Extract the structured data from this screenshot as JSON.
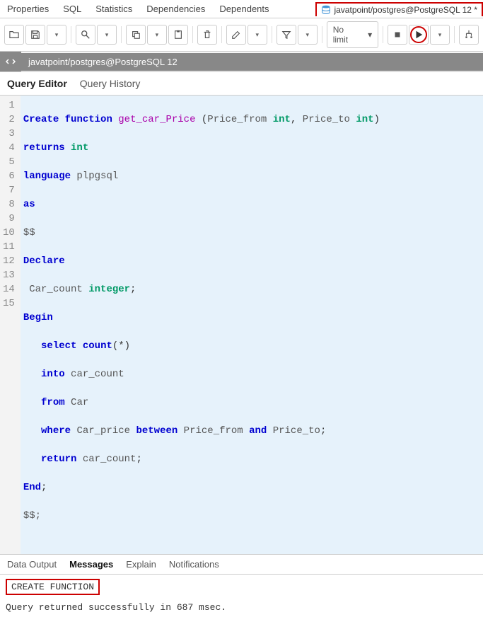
{
  "topTabs": {
    "t0": "Properties",
    "t1": "SQL",
    "t2": "Statistics",
    "t3": "Dependencies",
    "t4": "Dependents"
  },
  "connTab": "javatpoint/postgres@PostgreSQL 12 *",
  "noLimit": "No limit",
  "connBar": "javatpoint/postgres@PostgreSQL 12",
  "queryTabs": {
    "editor": "Query Editor",
    "history": "Query History"
  },
  "lines": {
    "l1": "1",
    "l2": "2",
    "l3": "3",
    "l4": "4",
    "l5": "5",
    "l6": "6",
    "l7": "7",
    "l8": "8",
    "l9": "9",
    "l10": "10",
    "l11": "11",
    "l12": "12",
    "l13": "13",
    "l14": "14",
    "l15": "15"
  },
  "code": {
    "create": "Create",
    "function": "function",
    "fname": "get_car_Price",
    "open": " (",
    "pf": "Price_from ",
    "int1": "int",
    "comma": ", ",
    "pt": "Price_to ",
    "int2": "int",
    "close": ")",
    "returns": "returns",
    "int3": " int",
    "language": "language",
    "plpgsql": " plpgsql",
    "as": "as",
    "dol1": "$$",
    "declare": "Declare",
    "cc": " Car_count ",
    "integer": "integer",
    "semi1": ";",
    "begin": "Begin",
    "select": "select",
    "count": "count",
    "star": "(*)",
    "into": "into",
    "cc2": " car_count",
    "from": "from",
    "car": " Car",
    "where": "where",
    "cp": " Car_price ",
    "between": "between",
    "pf2": " Price_from ",
    "and": "and",
    "pt2": " Price_to",
    "semi2": ";",
    "return": "return",
    "cc3": " car_count",
    "semi3": ";",
    "end": "End",
    "semi4": ";",
    "dol2": "$$;"
  },
  "outTabs": {
    "data": "Data Output",
    "msg": "Messages",
    "explain": "Explain",
    "notif": "Notifications"
  },
  "msg": {
    "result": "CREATE FUNCTION",
    "status": "Query returned successfully in 687 msec."
  }
}
